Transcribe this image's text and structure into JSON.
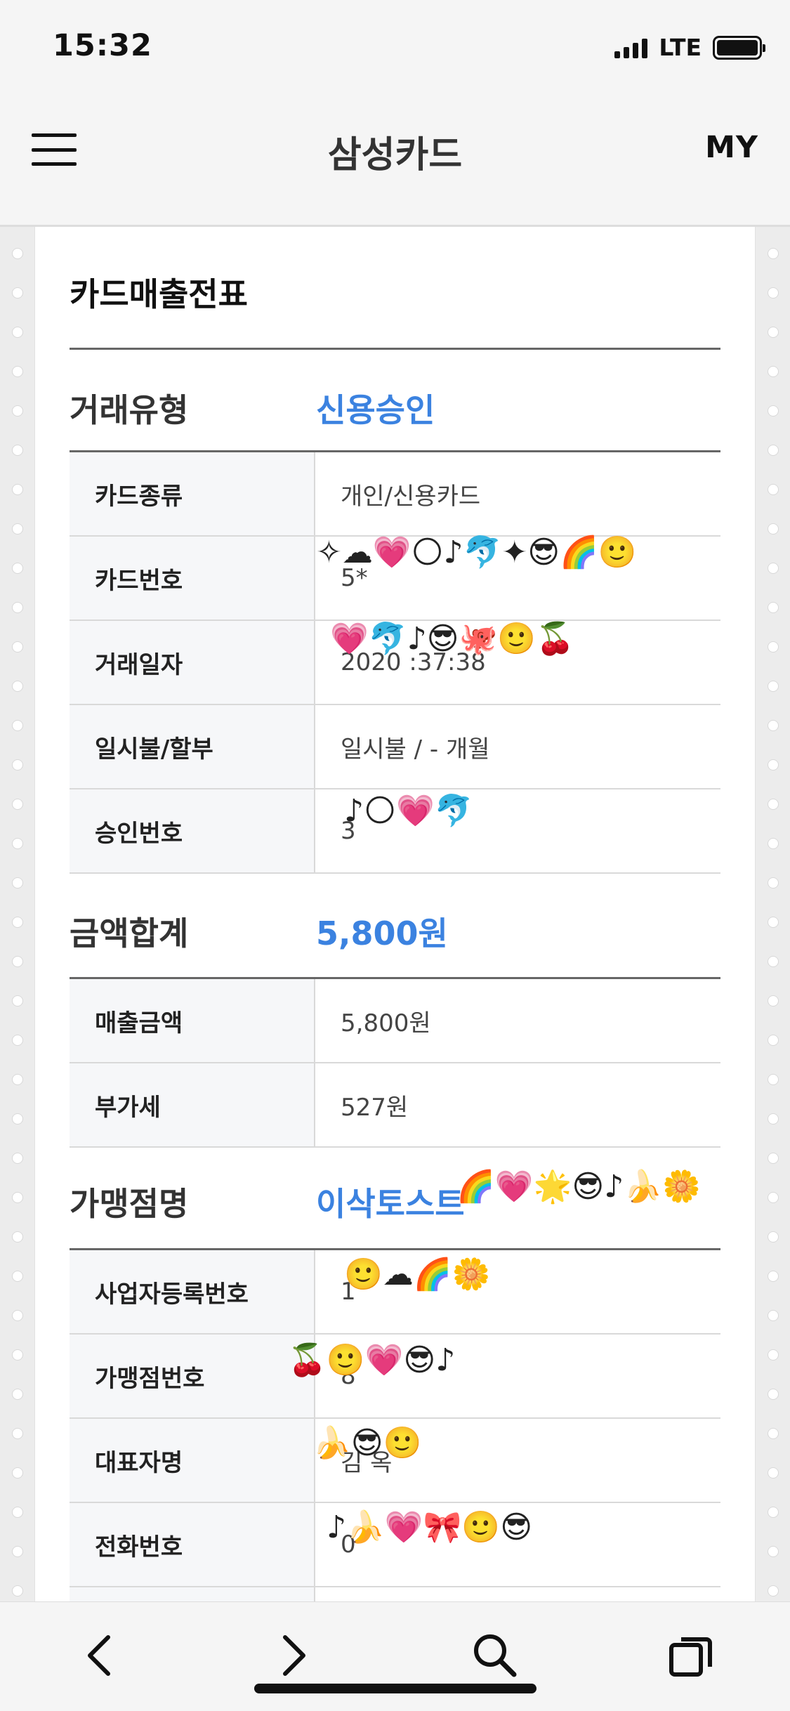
{
  "status_bar": {
    "time": "15:32",
    "network": "LTE",
    "icons": [
      "signal-icon",
      "battery-icon"
    ]
  },
  "header": {
    "title": "삼성카드",
    "my_label": "MY",
    "menu_icon": "hamburger-menu-icon"
  },
  "receipt": {
    "title": "카드매출전표",
    "transaction": {
      "label": "거래유형",
      "value": "신용승인",
      "rows": [
        {
          "label": "카드종류",
          "value": "개인/신용카드"
        },
        {
          "label": "카드번호",
          "value": "5*"
        },
        {
          "label": "거래일자",
          "value": "2020   :37:38"
        },
        {
          "label": "일시불/할부",
          "value": "일시불 / - 개월"
        },
        {
          "label": "승인번호",
          "value": "3"
        }
      ]
    },
    "amount": {
      "label": "금액합계",
      "value": "5,800원",
      "rows": [
        {
          "label": "매출금액",
          "value": "5,800원"
        },
        {
          "label": "부가세",
          "value": "527원"
        }
      ]
    },
    "merchant": {
      "label": "가맹점명",
      "value": "이삭토스트",
      "rows": [
        {
          "label": "사업자등록번호",
          "value": "1"
        },
        {
          "label": "가맹점번호",
          "value": "8"
        },
        {
          "label": "대표자명",
          "value": "김 옥"
        },
        {
          "label": "전화번호",
          "value": "0"
        }
      ]
    }
  },
  "toolbar": {
    "buttons": [
      "back-icon",
      "forward-icon",
      "search-icon",
      "tabs-icon"
    ]
  },
  "colors": {
    "accent": "#3b82e0",
    "label_bg": "#f6f7f9"
  }
}
